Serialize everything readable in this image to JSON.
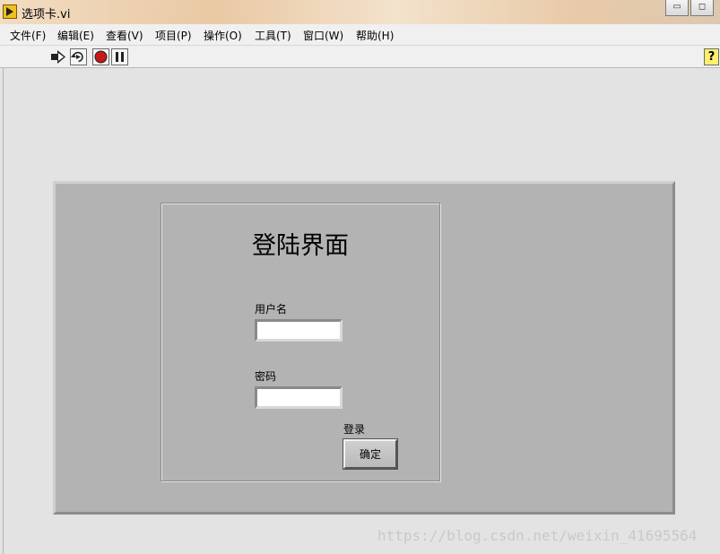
{
  "window": {
    "title": "选项卡.vi",
    "controls": {
      "minimize": "▭",
      "maximize": "◻"
    }
  },
  "menu": [
    "文件(F)",
    "编辑(E)",
    "查看(V)",
    "项目(P)",
    "操作(O)",
    "工具(T)",
    "窗口(W)",
    "帮助(H)"
  ],
  "toolbar": {
    "icons": [
      "run-icon",
      "run-continuously-icon",
      "abort-icon",
      "pause-icon"
    ],
    "help": "?"
  },
  "login": {
    "title": "登陆界面",
    "username_label": "用户名",
    "username_value": "",
    "password_label": "密码",
    "password_value": "",
    "login_label": "登录",
    "confirm_button": "确定"
  },
  "watermark": "https://blog.csdn.net/weixin_41695564"
}
